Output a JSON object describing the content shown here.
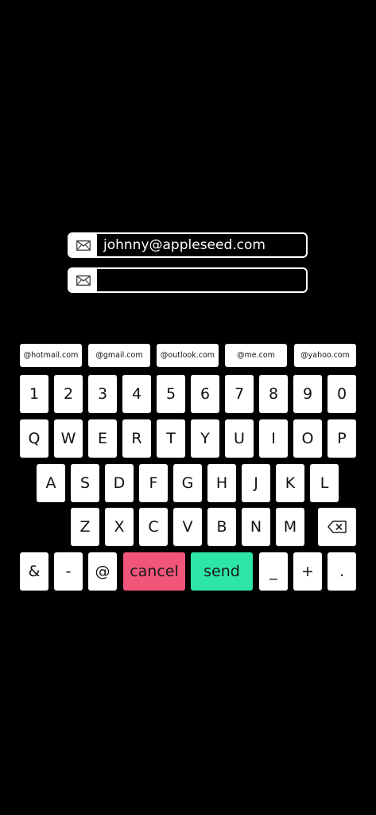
{
  "form": {
    "email_field": {
      "icon": "mail-icon",
      "value": "johnny@appleseed.com"
    },
    "second_field": {
      "icon": "mail-icon",
      "value": ""
    }
  },
  "keyboard": {
    "domains": [
      "@hotmail.com",
      "@gmail.com",
      "@outlook.com",
      "@me.com",
      "@yahoo.com"
    ],
    "digits": [
      "1",
      "2",
      "3",
      "4",
      "5",
      "6",
      "7",
      "8",
      "9",
      "0"
    ],
    "row1": [
      "Q",
      "W",
      "E",
      "R",
      "T",
      "Y",
      "U",
      "I",
      "O",
      "P"
    ],
    "row2": [
      "A",
      "S",
      "D",
      "F",
      "G",
      "H",
      "J",
      "K",
      "L"
    ],
    "row3": [
      "Z",
      "X",
      "C",
      "V",
      "B",
      "N",
      "M"
    ],
    "backspace_icon": "backspace-icon",
    "bottom_left": [
      "&",
      "-",
      "@"
    ],
    "cancel_label": "cancel",
    "send_label": "send",
    "bottom_right": [
      "_",
      "+",
      "."
    ]
  },
  "colors": {
    "background": "#000000",
    "key": "#ffffff",
    "cancel": "#f2557a",
    "send": "#2ee6a5"
  }
}
